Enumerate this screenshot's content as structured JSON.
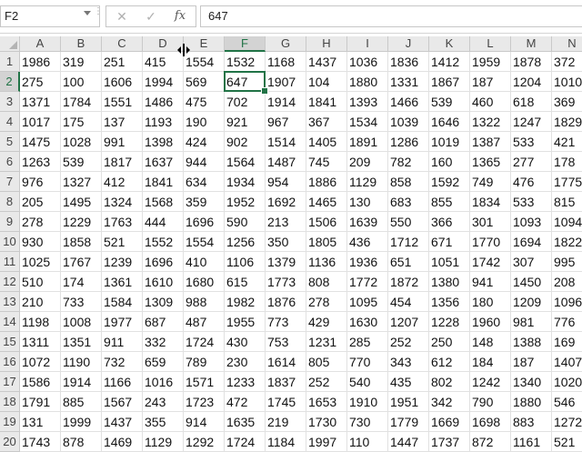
{
  "name_box": {
    "value": "F2"
  },
  "formula_bar": {
    "cancel_icon": "close-icon",
    "enter_icon": "check-icon",
    "fx_label": "fx",
    "content": "647"
  },
  "columns": [
    "A",
    "B",
    "C",
    "D",
    "E",
    "F",
    "G",
    "H",
    "I",
    "J",
    "K",
    "L",
    "M",
    "N"
  ],
  "selected_column": "F",
  "selected_row": 2,
  "active_cell": "F2",
  "rows": [
    {
      "n": "1",
      "cells": [
        "1986",
        "319",
        "251",
        "415",
        "1554",
        "1532",
        "1168",
        "1437",
        "1036",
        "1836",
        "1412",
        "1959",
        "1878",
        "372"
      ]
    },
    {
      "n": "2",
      "cells": [
        "275",
        "100",
        "1606",
        "1994",
        "569",
        "647",
        "1907",
        "104",
        "1880",
        "1331",
        "1867",
        "187",
        "1204",
        "1010"
      ]
    },
    {
      "n": "3",
      "cells": [
        "1371",
        "1784",
        "1551",
        "1486",
        "475",
        "702",
        "1914",
        "1841",
        "1393",
        "1466",
        "539",
        "460",
        "618",
        "369"
      ]
    },
    {
      "n": "4",
      "cells": [
        "1017",
        "175",
        "137",
        "1193",
        "190",
        "921",
        "967",
        "367",
        "1534",
        "1039",
        "1646",
        "1322",
        "1247",
        "1829"
      ]
    },
    {
      "n": "5",
      "cells": [
        "1475",
        "1028",
        "991",
        "1398",
        "424",
        "902",
        "1514",
        "1405",
        "1891",
        "1286",
        "1019",
        "1387",
        "533",
        "421"
      ]
    },
    {
      "n": "6",
      "cells": [
        "1263",
        "539",
        "1817",
        "1637",
        "944",
        "1564",
        "1487",
        "745",
        "209",
        "782",
        "160",
        "1365",
        "277",
        "178"
      ]
    },
    {
      "n": "7",
      "cells": [
        "976",
        "1327",
        "412",
        "1841",
        "634",
        "1934",
        "954",
        "1886",
        "1129",
        "858",
        "1592",
        "749",
        "476",
        "1775"
      ]
    },
    {
      "n": "8",
      "cells": [
        "205",
        "1495",
        "1324",
        "1568",
        "359",
        "1952",
        "1692",
        "1465",
        "130",
        "683",
        "855",
        "1834",
        "533",
        "815"
      ]
    },
    {
      "n": "9",
      "cells": [
        "278",
        "1229",
        "1763",
        "444",
        "1696",
        "590",
        "213",
        "1506",
        "1639",
        "550",
        "366",
        "301",
        "1093",
        "1094"
      ]
    },
    {
      "n": "10",
      "cells": [
        "930",
        "1858",
        "521",
        "1552",
        "1554",
        "1256",
        "350",
        "1805",
        "436",
        "1712",
        "671",
        "1770",
        "1694",
        "1822"
      ]
    },
    {
      "n": "11",
      "cells": [
        "1025",
        "1767",
        "1239",
        "1696",
        "410",
        "1106",
        "1379",
        "1136",
        "1936",
        "651",
        "1051",
        "1742",
        "307",
        "995"
      ]
    },
    {
      "n": "12",
      "cells": [
        "510",
        "174",
        "1361",
        "1610",
        "1680",
        "615",
        "1773",
        "808",
        "1772",
        "1872",
        "1380",
        "941",
        "1450",
        "208"
      ]
    },
    {
      "n": "13",
      "cells": [
        "210",
        "733",
        "1584",
        "1309",
        "988",
        "1982",
        "1876",
        "278",
        "1095",
        "454",
        "1356",
        "180",
        "1209",
        "1096"
      ]
    },
    {
      "n": "14",
      "cells": [
        "1198",
        "1008",
        "1977",
        "687",
        "487",
        "1955",
        "773",
        "429",
        "1630",
        "1207",
        "1228",
        "1960",
        "981",
        "776"
      ]
    },
    {
      "n": "15",
      "cells": [
        "1311",
        "1351",
        "911",
        "332",
        "1724",
        "430",
        "753",
        "1231",
        "285",
        "252",
        "250",
        "148",
        "1388",
        "169"
      ]
    },
    {
      "n": "16",
      "cells": [
        "1072",
        "1190",
        "732",
        "659",
        "789",
        "230",
        "1614",
        "805",
        "770",
        "343",
        "612",
        "184",
        "187",
        "1407"
      ]
    },
    {
      "n": "17",
      "cells": [
        "1586",
        "1914",
        "1166",
        "1016",
        "1571",
        "1233",
        "1837",
        "252",
        "540",
        "435",
        "802",
        "1242",
        "1340",
        "1020"
      ]
    },
    {
      "n": "18",
      "cells": [
        "1791",
        "885",
        "1567",
        "243",
        "1723",
        "472",
        "1745",
        "1653",
        "1910",
        "1951",
        "342",
        "790",
        "1880",
        "546"
      ]
    },
    {
      "n": "19",
      "cells": [
        "131",
        "1999",
        "1437",
        "355",
        "914",
        "1635",
        "219",
        "1730",
        "730",
        "1779",
        "1669",
        "1698",
        "883",
        "1272"
      ]
    },
    {
      "n": "20",
      "cells": [
        "1743",
        "878",
        "1469",
        "1129",
        "1292",
        "1724",
        "1184",
        "1997",
        "110",
        "1447",
        "1737",
        "872",
        "1161",
        "521"
      ]
    }
  ],
  "colors": {
    "accent": "#217346",
    "header_bg": "#e9e9e9",
    "gridline": "#e1e1e1"
  }
}
